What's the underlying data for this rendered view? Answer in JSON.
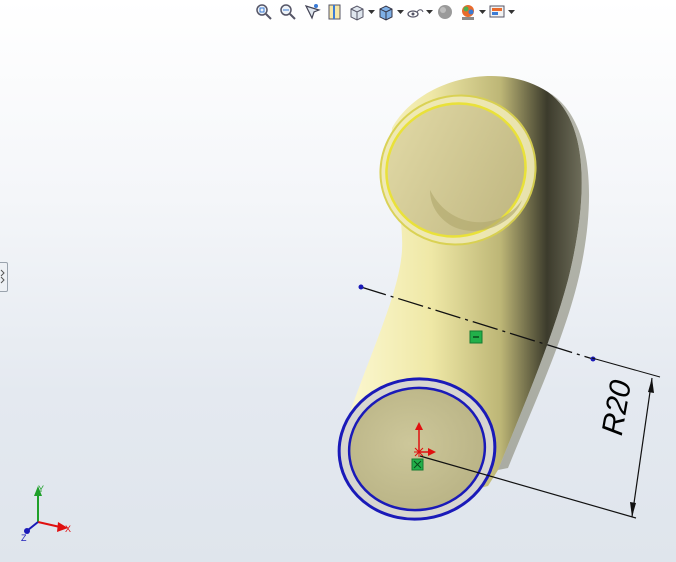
{
  "toolbar": {
    "items": [
      {
        "icon": "zoom-to-fit-icon"
      },
      {
        "icon": "zoom-to-area-icon"
      },
      {
        "icon": "previous-view-icon"
      },
      {
        "icon": "section-view-icon"
      },
      {
        "icon": "view-orientation-icon"
      },
      {
        "icon": "display-style-icon"
      },
      {
        "icon": "hide-show-items-icon"
      },
      {
        "icon": "edit-appearance-icon"
      },
      {
        "icon": "apply-scene-icon"
      },
      {
        "icon": "view-settings-icon"
      }
    ]
  },
  "dimension": {
    "label": "R20"
  },
  "triad": {
    "x_label": "X",
    "y_label": "Y",
    "z_label": "Z"
  },
  "colors": {
    "part_fill": "#d8d29a",
    "selected_edge": "#1a1ab8",
    "highlight_edge": "#e9e13a",
    "origin_red": "#e01010",
    "relation_green": "#22b04a"
  }
}
